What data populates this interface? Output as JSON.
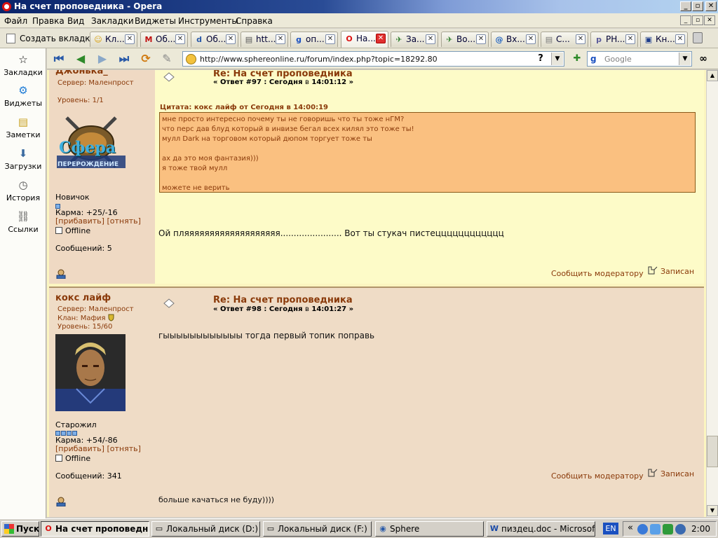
{
  "window": {
    "title": "На счет проповедника - Opera"
  },
  "menu": [
    "Файл",
    "Правка",
    "Вид",
    "Закладки",
    "Виджеты",
    "Инструменты",
    "Справка"
  ],
  "tabs": {
    "new_tab": "Создать вкладку",
    "items": [
      {
        "icon": "smiley-icon",
        "label": "Кл..."
      },
      {
        "icon": "m-icon",
        "label": "Об..."
      },
      {
        "icon": "ds-icon",
        "label": "Об..."
      },
      {
        "icon": "page-icon",
        "label": "htt..."
      },
      {
        "icon": "google-icon",
        "label": "оп..."
      },
      {
        "icon": "opera-icon",
        "label": "На...",
        "active": true
      },
      {
        "icon": "runner-icon",
        "label": "За..."
      },
      {
        "icon": "runner-icon",
        "label": "Во..."
      },
      {
        "icon": "at-icon",
        "label": "Вх..."
      },
      {
        "icon": "doc-icon",
        "label": "С..."
      },
      {
        "icon": "php-icon",
        "label": "PH..."
      },
      {
        "icon": "book-icon",
        "label": "Кн..."
      }
    ]
  },
  "sidepanel": [
    "Закладки",
    "Виджеты",
    "Заметки",
    "Загрузки",
    "История",
    "Ссылки"
  ],
  "address": {
    "url": "http://www.sphereonline.ru/forum/index.php?topic=18292.80",
    "help": "?"
  },
  "search": {
    "placeholder": "Google"
  },
  "posts": [
    {
      "author": "Джонька_",
      "server": "Сервер: Маленпрост",
      "level": "Уровень: 1/1",
      "avatar_text": "Сфера",
      "avatar_sub": "ПЕРЕРОЖДЕНИЕ",
      "rank": "Новичок",
      "pips": 1,
      "karma": "Карма: +25/-16",
      "karma_links": "[прибавить] [отнять]",
      "status": "Offline",
      "messages": "Сообщений: 5",
      "title": "Re: На счет проповедника",
      "reply_prefix": "« Ответ #97 : Сегодня",
      "reply_mid": "в",
      "reply_time": "14:01:12 »",
      "quote_head": "Цитата: кокс лайф от Сегодня в 14:00:19",
      "quote_lines": [
        "мне просто интересно почему ты не говоришь что ты тоже нГМ?",
        "что перс дав блуд который в инвизе бегал всех килял это тоже ты!",
        "мулл Dark на торговом который дюпом торгует тоже ты",
        "",
        "ах да это моя фантазия)))",
        "я тоже твой мулл",
        "",
        "можете не верить"
      ],
      "body": "Ой пляяяяяяяяяяяяяяяяяяя....................... Вот ты стукач пистецццццццццццц",
      "report": "Сообщить модератору",
      "logged": "Записан"
    },
    {
      "author": "кокс лайф",
      "server": "Сервер: Маленпрост",
      "clan": "Клан: Мафия",
      "level": "Уровень: 15/60",
      "rank": "Старожил",
      "pips": 4,
      "karma": "Карма: +54/-86",
      "karma_links": "[прибавить] [отнять]",
      "status": "Offline",
      "messages": "Сообщений: 341",
      "title": "Re: На счет проповедника",
      "reply_prefix": "« Ответ #98 : Сегодня",
      "reply_mid": "в",
      "reply_time": "14:01:27 »",
      "body": "гыыыыыыыыыыыы тогда первый топик поправь",
      "report": "Сообщить модератору",
      "logged": "Записан",
      "signature": "больше качаться не буду))))"
    }
  ],
  "taskbar": {
    "start": "Пуск",
    "tasks": [
      {
        "label": "На счет проповедни...",
        "active": true
      },
      {
        "label": "Локальный диск (D:)"
      },
      {
        "label": "Локальный диск (F:)"
      },
      {
        "label": "Sphere"
      },
      {
        "label": "пиздец.doc - Microsoft ..."
      }
    ],
    "lang": "EN",
    "clock": "2:00"
  }
}
